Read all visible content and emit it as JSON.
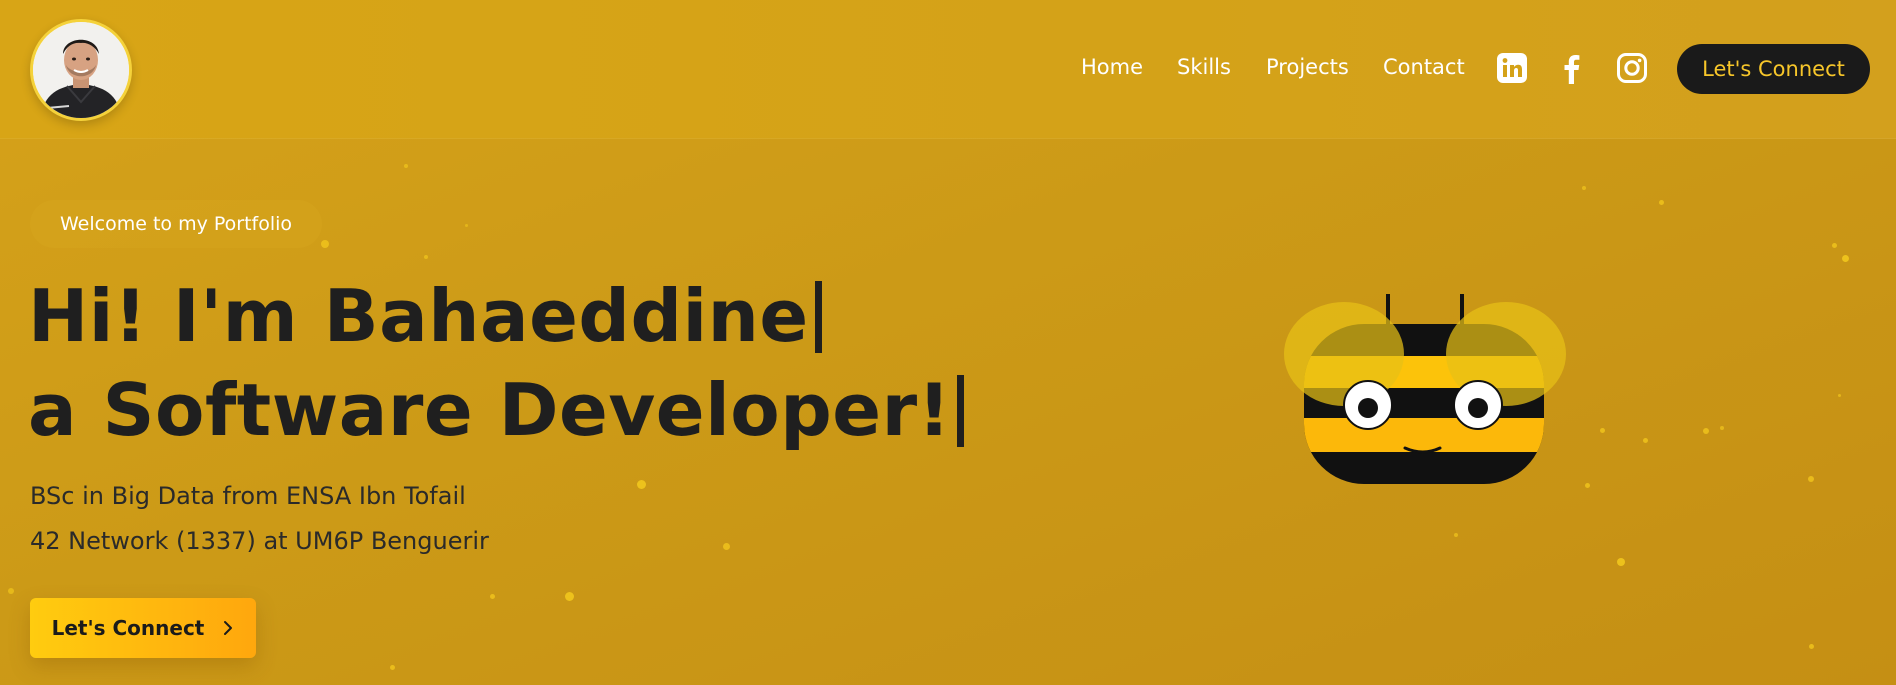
{
  "nav": {
    "items": [
      {
        "label": "Home"
      },
      {
        "label": "Skills"
      },
      {
        "label": "Projects"
      },
      {
        "label": "Contact"
      }
    ],
    "social_icons": [
      "linkedin-icon",
      "facebook-icon",
      "instagram-icon"
    ],
    "connect_label": "Let's Connect"
  },
  "hero": {
    "welcome": "Welcome to my Portfolio",
    "line1": "Hi! I'm Bahaeddine",
    "line2": "a Software Developer!",
    "sub1": "BSc in Big Data from ENSA Ibn Tofail",
    "sub2": "42 Network (1337) at UM6P Benguerir",
    "cta_label": "Let's Connect",
    "cta_icon": "chevron-right-icon"
  },
  "illustration": "bee-icon",
  "colors": {
    "background": "#cc9a17",
    "accent": "#f7c62a",
    "dark": "#1a1a1a",
    "cta_gradient_start": "#ffcc0f",
    "cta_gradient_end": "#ffa70d"
  }
}
